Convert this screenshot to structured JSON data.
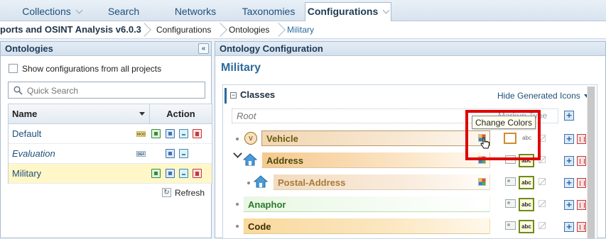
{
  "tabs": [
    {
      "label": "Collections",
      "has_menu": true
    },
    {
      "label": "Search",
      "has_menu": false
    },
    {
      "label": "Networks",
      "has_menu": false
    },
    {
      "label": "Taxonomies",
      "has_menu": false
    },
    {
      "label": "Configurations",
      "has_menu": true,
      "active": true
    }
  ],
  "breadcrumb": [
    "ports and OSINT Analysis v6.0.3",
    "Configurations",
    "Ontologies",
    "Military"
  ],
  "left_panel": {
    "title": "Ontologies",
    "show_all_label": "Show configurations from all projects",
    "search_placeholder": "Quick Search",
    "columns": {
      "name": "Name",
      "action": "Action"
    },
    "rows": [
      {
        "name": "Default",
        "badge": "MOD",
        "italic": false,
        "selected": false
      },
      {
        "name": "Evaluation",
        "badge": "DEF",
        "italic": true,
        "selected": false
      },
      {
        "name": "Military",
        "badge": "",
        "italic": false,
        "selected": true
      }
    ],
    "refresh_label": "Refresh"
  },
  "right_panel": {
    "header": "Ontology Configuration",
    "title": "Military",
    "section_label": "Classes",
    "hide_generated": "Hide Generated Icons",
    "root_label": "Root",
    "markup_type_label": "Markup Type",
    "tooltip": "Change Colors",
    "classes": [
      {
        "name": "Vehicle",
        "icon": "v"
      },
      {
        "name": "Address",
        "icon": "house"
      },
      {
        "name": "Postal-Address",
        "icon": "house"
      },
      {
        "name": "Anaphor",
        "icon": ""
      },
      {
        "name": "Code",
        "icon": ""
      }
    ]
  },
  "colors": {
    "accent": "#2b6a9b",
    "highlight": "#e00000",
    "selected_row": "#fff7c7"
  }
}
